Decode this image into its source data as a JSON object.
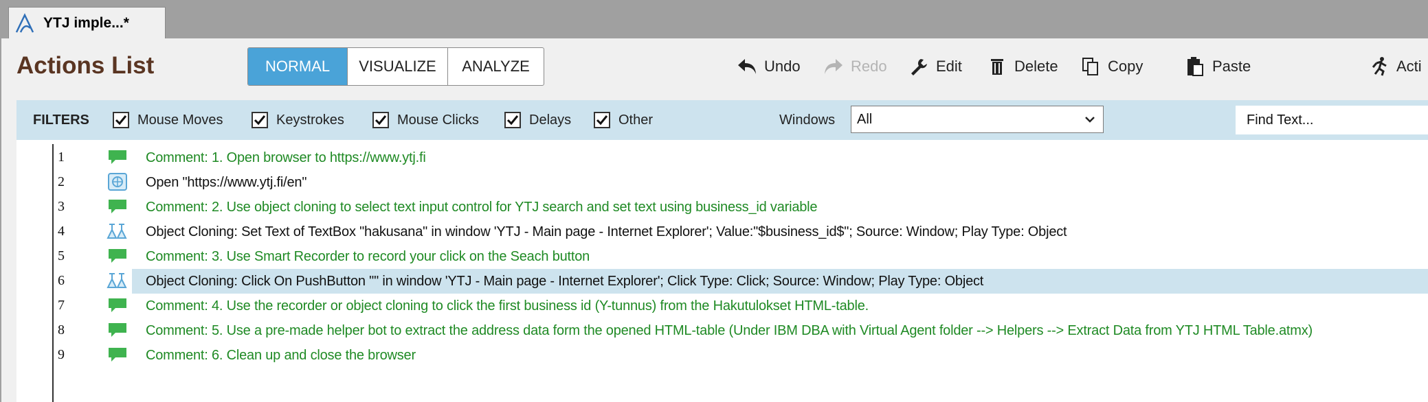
{
  "tab": {
    "title": "YTJ imple...*"
  },
  "header": {
    "title": "Actions List",
    "modes": [
      {
        "label": "NORMAL",
        "active": true
      },
      {
        "label": "VISUALIZE",
        "active": false
      },
      {
        "label": "ANALYZE",
        "active": false
      }
    ],
    "toolbar": {
      "undo": "Undo",
      "redo": "Redo",
      "edit": "Edit",
      "delete": "Delete",
      "copy": "Copy",
      "paste": "Paste",
      "actions": "Acti"
    }
  },
  "filters": {
    "label": "FILTERS",
    "items": [
      {
        "label": "Mouse Moves",
        "checked": true
      },
      {
        "label": "Keystrokes",
        "checked": true
      },
      {
        "label": "Mouse Clicks",
        "checked": true
      },
      {
        "label": "Delays",
        "checked": true
      },
      {
        "label": "Other",
        "checked": true
      }
    ],
    "windows_label": "Windows",
    "windows_value": "All",
    "find_placeholder": "Find Text..."
  },
  "rows": [
    {
      "num": "1",
      "icon": "comment-icon",
      "type": "comment",
      "text": "Comment: 1. Open browser to https://www.ytj.fi"
    },
    {
      "num": "2",
      "icon": "browser-icon",
      "type": "action",
      "text": "Open \"https://www.ytj.fi/en\""
    },
    {
      "num": "3",
      "icon": "comment-icon",
      "type": "comment",
      "text": "Comment: 2. Use object cloning to select text input control for YTJ search and set text using business_id variable"
    },
    {
      "num": "4",
      "icon": "object-cloning-icon",
      "type": "action",
      "text": "Object Cloning: Set Text of TextBox \"hakusana\" in window 'YTJ - Main page - Internet Explorer'; Value:\"$business_id$\"; Source: Window; Play Type: Object"
    },
    {
      "num": "5",
      "icon": "comment-icon",
      "type": "comment",
      "text": "Comment: 3. Use Smart Recorder to record your click on the Seach button"
    },
    {
      "num": "6",
      "icon": "object-cloning-icon",
      "type": "action",
      "selected": true,
      "text": "Object Cloning: Click On PushButton \"\" in window 'YTJ - Main page - Internet Explorer'; Click Type: Click; Source: Window; Play Type: Object"
    },
    {
      "num": "7",
      "icon": "comment-icon",
      "type": "comment",
      "text": "Comment: 4. Use the recorder or object cloning to click the first business id (Y-tunnus) from the Hakutulokset HTML-table."
    },
    {
      "num": "8",
      "icon": "comment-icon",
      "type": "comment",
      "text": "Comment: 5. Use a pre-made helper bot to extract the address data form the opened HTML-table (Under IBM DBA with Virtual Agent folder --> Helpers --> Extract Data from YTJ HTML Table.atmx)"
    },
    {
      "num": "9",
      "icon": "comment-icon",
      "type": "comment",
      "text": "Comment: 6. Clean up and close the browser"
    }
  ],
  "colors": {
    "accent": "#4aa3d8",
    "title_brown": "#5a3522",
    "comment_green": "#1f8a24",
    "filter_bar": "#cde3ee",
    "selected_row": "#cde3ee"
  }
}
